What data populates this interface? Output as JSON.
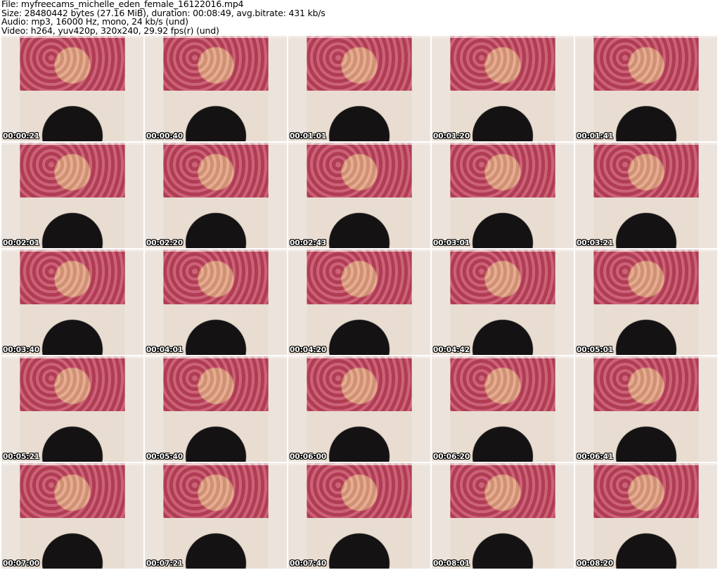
{
  "info": {
    "file": "File: myfreecams_michelle_eden_female_16122016.mp4",
    "size": "Size: 28480442 bytes (27.16 MiB), duration: 00:08:49, avg.bitrate: 431 kb/s",
    "audio": "Audio: mp3, 16000 Hz, mono, 24 kb/s (und)",
    "video": "Video: h264, yuv420p, 320x240, 29.92 fps(r) (und)"
  },
  "timestamps": [
    "00:00:21",
    "00:00:40",
    "00:01:01",
    "00:01:20",
    "00:01:41",
    "00:02:01",
    "00:02:20",
    "00:02:43",
    "00:03:01",
    "00:03:21",
    "00:03:40",
    "00:04:01",
    "00:04:20",
    "00:04:42",
    "00:05:01",
    "00:05:21",
    "00:05:40",
    "00:06:00",
    "00:06:20",
    "00:06:41",
    "00:07:00",
    "00:07:21",
    "00:07:40",
    "00:08:01",
    "00:08:20"
  ]
}
